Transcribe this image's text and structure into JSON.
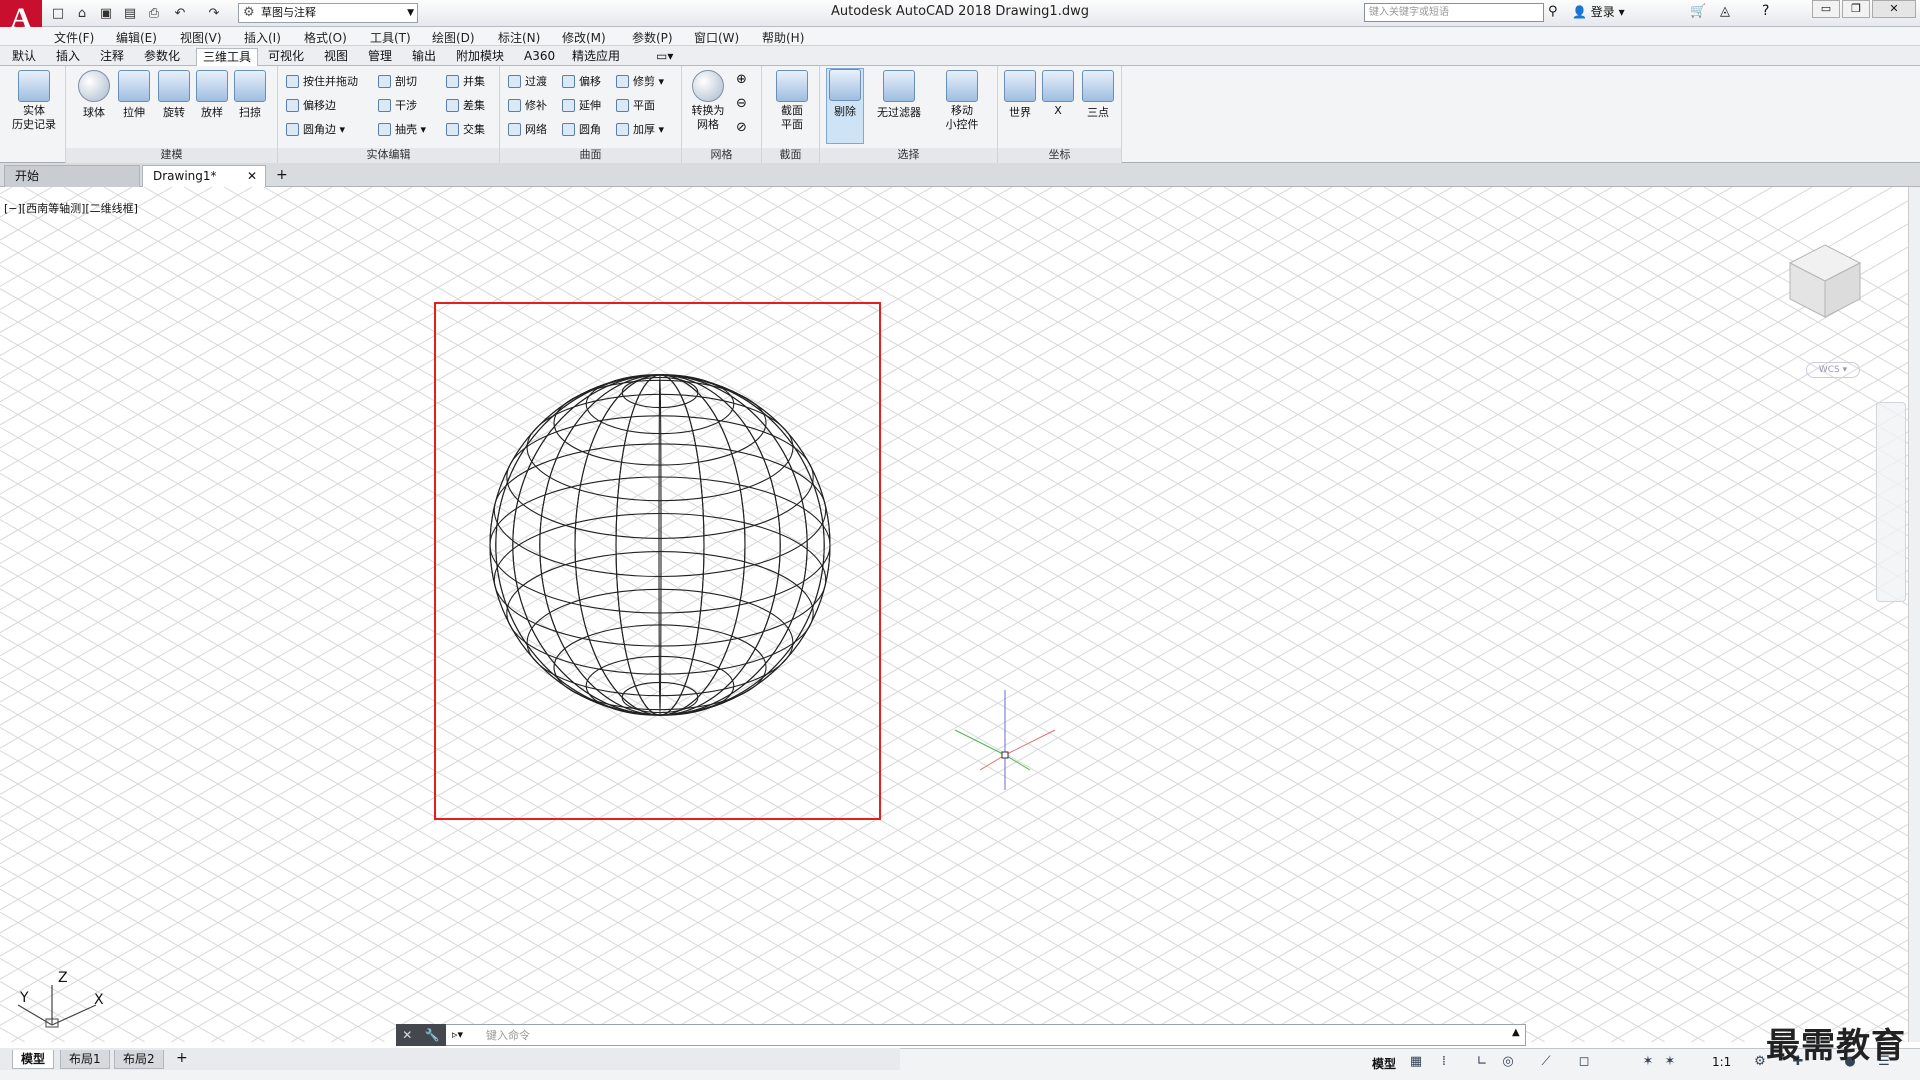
{
  "app": {
    "logo": "A",
    "title": "Autodesk AutoCAD 2018    Drawing1.dwg"
  },
  "quick_access": {
    "workspace": "草图与注释"
  },
  "help": {
    "search_placeholder": "键入关键字或短语",
    "login": "登录"
  },
  "menus": [
    "文件(F)",
    "编辑(E)",
    "视图(V)",
    "插入(I)",
    "格式(O)",
    "工具(T)",
    "绘图(D)",
    "标注(N)",
    "修改(M)",
    "参数(P)",
    "窗口(W)",
    "帮助(H)"
  ],
  "ribbon_tabs": [
    "默认",
    "插入",
    "注释",
    "参数化",
    "三维工具",
    "可视化",
    "视图",
    "管理",
    "输出",
    "附加模块",
    "A360",
    "精选应用"
  ],
  "active_ribbon_tab": "三维工具",
  "panels": {
    "history": {
      "label": "实体\n历史记录"
    },
    "modeling": {
      "title": "建模",
      "buttons": [
        "球体",
        "拉伸",
        "旋转",
        "放样",
        "扫掠"
      ]
    },
    "solid_edit": {
      "title": "实体编辑",
      "buttons": [
        "按住并拖动",
        "偏移边",
        "圆角边",
        "剖切",
        "干涉",
        "抽壳",
        "并集",
        "差集",
        "交集"
      ]
    },
    "surface": {
      "title": "曲面",
      "buttons": [
        "过渡",
        "修补",
        "网络",
        "偏移",
        "延伸",
        "圆角",
        "修剪",
        "平面",
        "加厚"
      ]
    },
    "mesh": {
      "title": "网格",
      "buttons": [
        "转换为\n网格"
      ]
    },
    "section": {
      "title": "截面",
      "buttons": [
        "截面\n平面"
      ]
    },
    "selection": {
      "title": "选择",
      "buttons": [
        "剔除",
        "无过滤器",
        "移动\n小控件"
      ]
    },
    "coordinates": {
      "title": "坐标",
      "buttons": [
        "世界",
        "X",
        "三点"
      ]
    }
  },
  "doc_tabs": [
    "开始",
    "Drawing1*"
  ],
  "viewport_label": "[−][西南等轴测][二维线框]",
  "viewcube": {
    "wcs": "WCS"
  },
  "ucs": {
    "x": "X",
    "y": "Y",
    "z": "Z"
  },
  "command_line": {
    "placeholder": "键入命令"
  },
  "layout_tabs": [
    "模型",
    "布局1",
    "布局2"
  ],
  "status": {
    "model": "模型",
    "scale": "1:1"
  },
  "watermark": "最需教育",
  "colors": {
    "accent_red": "#e3211a",
    "ribbon_bg": "#f3f4f6",
    "grid_line": "#d8d8d8"
  }
}
